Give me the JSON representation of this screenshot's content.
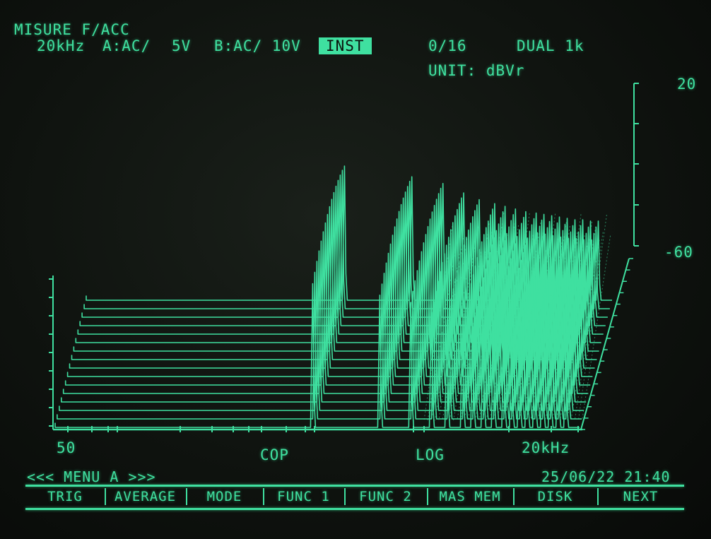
{
  "header": {
    "title": "MISURE F/ACC",
    "span": "20kHz",
    "ch_a": "A:AC/",
    "ch_a_range": "5V",
    "ch_b": "B:AC/ 10V",
    "mode_badge": "INST",
    "count": "0/16",
    "dual": "DUAL 1k",
    "unit": "UNIT: dBVr"
  },
  "axis": {
    "y_top": "20",
    "y_mid": "-60",
    "x_start": "50",
    "x_end": "20kHz",
    "cop_label": "COP",
    "log_label": "LOG"
  },
  "menu": {
    "label": "<<< MENU A >>>",
    "datetime": "25/06/22 21:40"
  },
  "softkeys": [
    {
      "label": "TRIG"
    },
    {
      "label": "AVERAGE"
    },
    {
      "label": "MODE"
    },
    {
      "label": "FUNC 1"
    },
    {
      "label": "FUNC 2"
    },
    {
      "label": "MAS MEM"
    },
    {
      "label": "DISK"
    },
    {
      "label": "NEXT"
    }
  ],
  "chart_data": {
    "type": "waterfall",
    "traces": 16,
    "x_scale": "log",
    "x_range": [
      "50",
      "20kHz"
    ],
    "y_unit": "dBVr",
    "y_labels": [
      20,
      -60
    ],
    "peaks": [
      {
        "freq_fraction": 0.5,
        "height": 1.0
      },
      {
        "freq_fraction": 0.63,
        "height": 0.92
      },
      {
        "freq_fraction": 0.69,
        "height": 0.87
      },
      {
        "freq_fraction": 0.73,
        "height": 0.8
      },
      {
        "freq_fraction": 0.76,
        "height": 0.75
      },
      {
        "freq_fraction": 0.79,
        "height": 0.72
      },
      {
        "freq_fraction": 0.81,
        "height": 0.7
      },
      {
        "freq_fraction": 0.83,
        "height": 0.68
      },
      {
        "freq_fraction": 0.85,
        "height": 0.66
      },
      {
        "freq_fraction": 0.87,
        "height": 0.65
      },
      {
        "freq_fraction": 0.885,
        "height": 0.64
      },
      {
        "freq_fraction": 0.9,
        "height": 0.63
      },
      {
        "freq_fraction": 0.915,
        "height": 0.62
      },
      {
        "freq_fraction": 0.93,
        "height": 0.61
      },
      {
        "freq_fraction": 0.945,
        "height": 0.6
      },
      {
        "freq_fraction": 0.96,
        "height": 0.6
      },
      {
        "freq_fraction": 0.975,
        "height": 0.59
      },
      {
        "freq_fraction": 0.99,
        "height": 0.59
      }
    ]
  }
}
